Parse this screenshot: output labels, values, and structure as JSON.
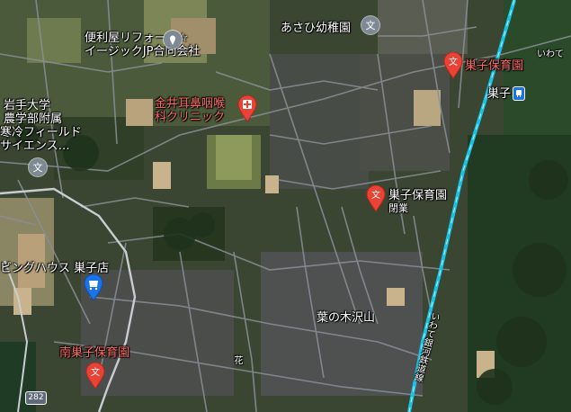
{
  "places": {
    "benriya": [
      "便利屋リフォーム☆",
      "イージックJP合同会社"
    ],
    "asahi": "あさひ幼稚園",
    "sugo_hoikuen_top": "巣子保育園",
    "sugo_station": "巣子",
    "kanai_clinic": [
      "金井耳鼻咽喉",
      "科クリニック"
    ],
    "iwate_univ": [
      "岩手大学",
      "農学部附属",
      "寒冷フィールド",
      "サイエンス…"
    ],
    "sugo_hoikuen_mid": "巣子保育園",
    "closed": "閉業",
    "living_house": "ビングハウス 巣子店",
    "hanoki": "葉の木沢山",
    "minami_sugo": "南巣子保育園",
    "route": "282",
    "rail_label": "いわて",
    "rail_vertical": "いわて銀河鉄道線",
    "road_left": "花"
  },
  "icons": {
    "school": "school-icon",
    "pin_red": "red-pin-icon",
    "gray_pin": "gray-pin-icon",
    "blue_pin": "shopping-pin-icon",
    "train": "train-icon",
    "medical": "medical-pin-icon"
  },
  "colors": {
    "pin_red": "#e94335",
    "gray_pin": "#7d8a94",
    "blue_pin": "#1a73e8",
    "rail": "#19c3e6",
    "road": "#8a8f98"
  }
}
